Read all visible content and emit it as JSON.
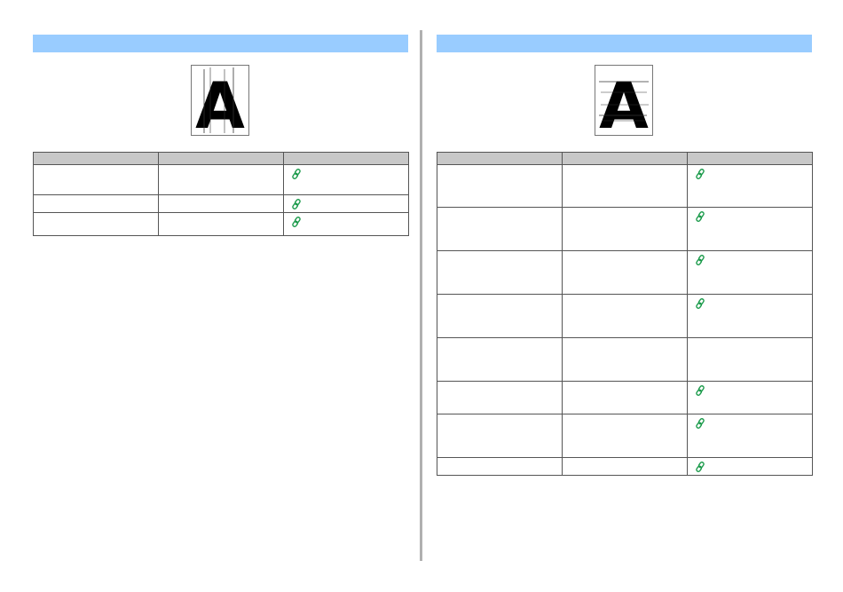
{
  "left_section": {
    "title": "",
    "headers": [
      "",
      "",
      ""
    ],
    "rows": [
      {
        "c1": "",
        "c2": "",
        "link": true
      },
      {
        "c1": "",
        "c2": "",
        "link": true
      },
      {
        "c1": "",
        "c2": "",
        "link": true
      }
    ]
  },
  "right_section": {
    "title": "",
    "headers": [
      "",
      "",
      ""
    ],
    "rows": [
      {
        "c1": "",
        "c2": "",
        "link": true
      },
      {
        "c1": "",
        "c2": "",
        "link": true
      },
      {
        "c1": "",
        "c2": "",
        "link": true
      },
      {
        "c1": "",
        "c2": "",
        "link": true
      },
      {
        "c1": "",
        "c2": "",
        "link": false
      },
      {
        "c1": "",
        "c2": "",
        "link": true
      },
      {
        "c1": "",
        "c2": "",
        "link": true
      },
      {
        "c1": "",
        "c2": "",
        "link": true
      }
    ]
  },
  "sample_letter": "A",
  "colors": {
    "title_bar": "#99ccff",
    "header": "#c8c8c8",
    "link_icon": "#1a9a4a",
    "divider": "#b0b0b0"
  },
  "icons": {
    "link": "link-icon"
  }
}
